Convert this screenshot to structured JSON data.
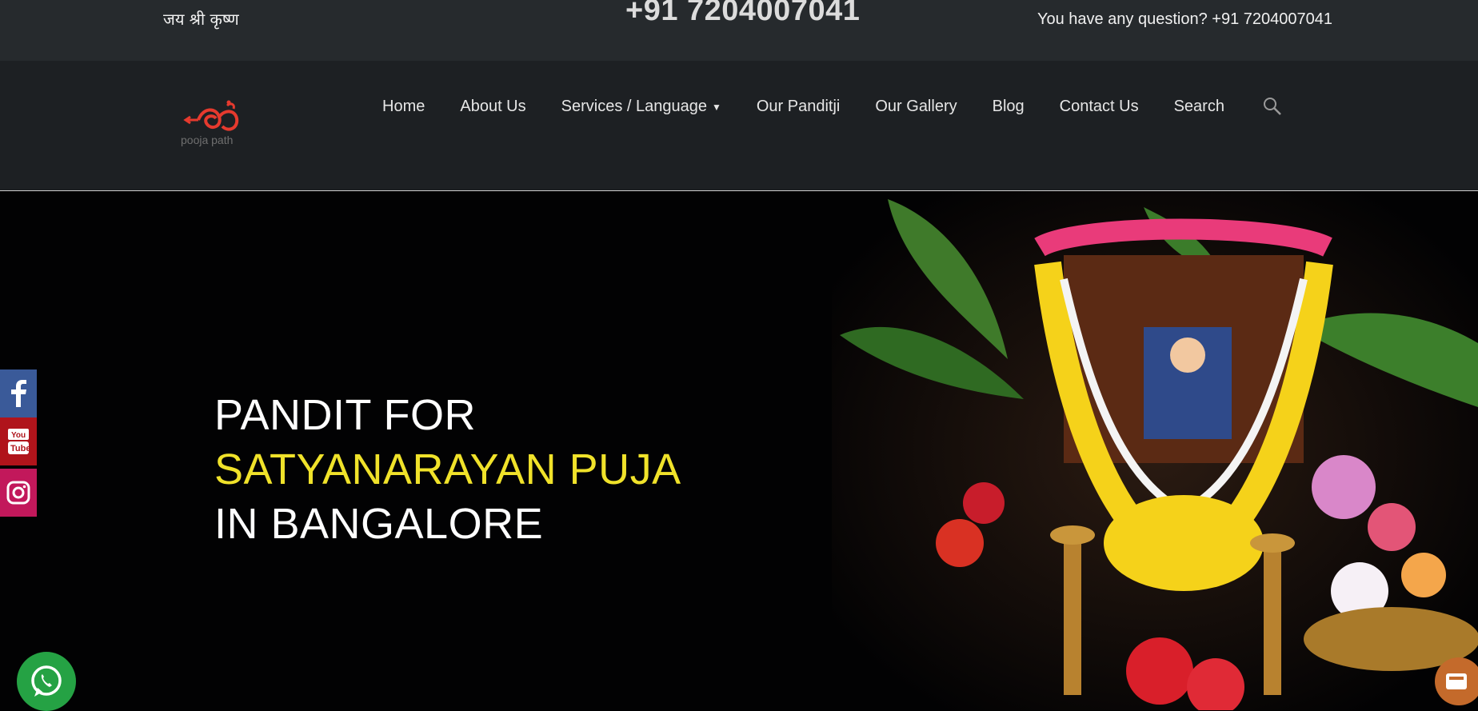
{
  "topbar": {
    "greeting": "जय श्री कृष्ण",
    "phone_big": "+91 7204007041",
    "question": "You have any question? +91 7204007041"
  },
  "logo": {
    "text": "pooja path"
  },
  "nav": {
    "items": [
      {
        "label": "Home"
      },
      {
        "label": "About Us"
      },
      {
        "label": "Services / Language"
      },
      {
        "label": "Our Panditji"
      },
      {
        "label": "Our Gallery"
      },
      {
        "label": "Blog"
      },
      {
        "label": "Contact Us"
      },
      {
        "label": "Search"
      }
    ]
  },
  "hero": {
    "line1": "PANDIT FOR",
    "line2": "SATYANARAYAN PUJA",
    "line3": "IN BANGALORE"
  },
  "colors": {
    "topbar_bg": "#262a2d",
    "nav_bg": "#1d2023",
    "hero_accent": "#f0e22a",
    "facebook": "#3a5a99",
    "youtube": "#b0141b",
    "instagram": "#c2185b",
    "whatsapp": "#25a244"
  },
  "icons": [
    "search-icon",
    "chevron-down-icon",
    "facebook-icon",
    "youtube-icon",
    "instagram-icon",
    "whatsapp-icon",
    "phone-icon"
  ]
}
